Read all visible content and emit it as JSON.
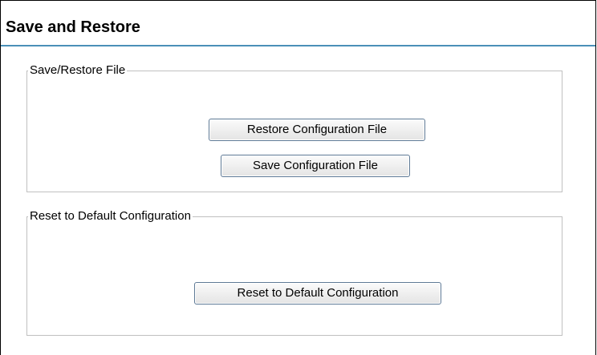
{
  "page": {
    "title": "Save and Restore"
  },
  "save_restore_section": {
    "legend": "Save/Restore File",
    "restore_button_label": "Restore Configuration File",
    "save_button_label": "Save Configuration File"
  },
  "reset_section": {
    "legend": "Reset to Default Configuration",
    "reset_button_label": "Reset to Default Configuration"
  },
  "colors": {
    "title_underline": "#4a90b8",
    "fieldset_border": "#c0c0c0",
    "button_border": "#5f7a96"
  }
}
